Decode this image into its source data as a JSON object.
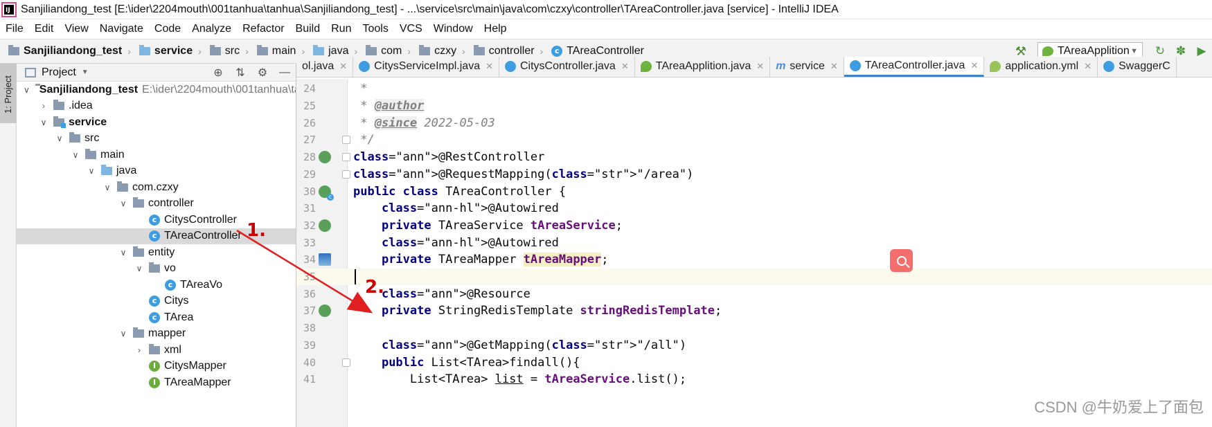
{
  "window": {
    "title": "Sanjiliandong_test [E:\\ider\\2204mouth\\001tanhua\\tanhua\\Sanjiliandong_test] - ...\\service\\src\\main\\java\\com\\czxy\\controller\\TAreaController.java [service] - IntelliJ IDEA"
  },
  "menu": [
    "File",
    "Edit",
    "View",
    "Navigate",
    "Code",
    "Analyze",
    "Refactor",
    "Build",
    "Run",
    "Tools",
    "VCS",
    "Window",
    "Help"
  ],
  "breadcrumb": [
    {
      "label": "Sanjiliandong_test",
      "icon": "folder",
      "bold": true
    },
    {
      "label": "service",
      "icon": "module-folder",
      "bold": true
    },
    {
      "label": "src",
      "icon": "folder"
    },
    {
      "label": "main",
      "icon": "folder"
    },
    {
      "label": "java",
      "icon": "source-folder"
    },
    {
      "label": "com",
      "icon": "folder"
    },
    {
      "label": "czxy",
      "icon": "folder"
    },
    {
      "label": "controller",
      "icon": "folder"
    },
    {
      "label": "TAreaController",
      "icon": "class-icon"
    }
  ],
  "toolbar": {
    "run_config": "TAreaApplition"
  },
  "left_stripe": {
    "label": "1: Project"
  },
  "project_panel": {
    "title": "Project",
    "tree": [
      {
        "label": "Sanjiliandong_test",
        "path": "E:\\ider\\2204mouth\\001tanhua\\tanh",
        "depth": 0,
        "expanded": true,
        "icon": "folder",
        "bold": true
      },
      {
        "label": ".idea",
        "depth": 1,
        "expanded": false,
        "icon": "folder"
      },
      {
        "label": "service",
        "depth": 1,
        "expanded": true,
        "icon": "module-folder",
        "bold": true
      },
      {
        "label": "src",
        "depth": 2,
        "expanded": true,
        "icon": "folder"
      },
      {
        "label": "main",
        "depth": 3,
        "expanded": true,
        "icon": "folder"
      },
      {
        "label": "java",
        "depth": 4,
        "expanded": true,
        "icon": "source-folder"
      },
      {
        "label": "com.czxy",
        "depth": 5,
        "expanded": true,
        "icon": "folder"
      },
      {
        "label": "controller",
        "depth": 6,
        "expanded": true,
        "icon": "folder"
      },
      {
        "label": "CitysController",
        "depth": 7,
        "icon": "class"
      },
      {
        "label": "TAreaController",
        "depth": 7,
        "icon": "class",
        "selected": true
      },
      {
        "label": "entity",
        "depth": 6,
        "expanded": true,
        "icon": "folder"
      },
      {
        "label": "vo",
        "depth": 7,
        "expanded": true,
        "icon": "folder"
      },
      {
        "label": "TAreaVo",
        "depth": 8,
        "icon": "class"
      },
      {
        "label": "Citys",
        "depth": 7,
        "icon": "class"
      },
      {
        "label": "TArea",
        "depth": 7,
        "icon": "class"
      },
      {
        "label": "mapper",
        "depth": 6,
        "expanded": true,
        "icon": "folder"
      },
      {
        "label": "xml",
        "depth": 7,
        "expanded": false,
        "icon": "folder"
      },
      {
        "label": "CitysMapper",
        "depth": 7,
        "icon": "interface"
      },
      {
        "label": "TAreaMapper",
        "depth": 7,
        "icon": "interface"
      }
    ]
  },
  "editor_tabs": [
    {
      "label": "ol.java",
      "icon": "none"
    },
    {
      "label": "CitysServiceImpl.java",
      "icon": "class"
    },
    {
      "label": "CitysController.java",
      "icon": "class"
    },
    {
      "label": "TAreaApplition.java",
      "icon": "spring"
    },
    {
      "label": "service",
      "icon": "m"
    },
    {
      "label": "TAreaController.java",
      "icon": "class",
      "active": true
    },
    {
      "label": "application.yml",
      "icon": "yml"
    },
    {
      "label": "SwaggerC",
      "icon": "class"
    }
  ],
  "code_lines": [
    {
      "n": "24",
      "text": " *"
    },
    {
      "n": "25",
      "text": " * @author"
    },
    {
      "n": "26",
      "text": " * @since 2022-05-03"
    },
    {
      "n": "27",
      "text": " */"
    },
    {
      "n": "28",
      "text": "@RestController"
    },
    {
      "n": "29",
      "text": "@RequestMapping(\"/area\")"
    },
    {
      "n": "30",
      "text": "public class TAreaController {"
    },
    {
      "n": "31",
      "text": "    @Autowired"
    },
    {
      "n": "32",
      "text": "    private TAreaService tAreaService;"
    },
    {
      "n": "33",
      "text": "    @Autowired"
    },
    {
      "n": "34",
      "text": "    private TAreaMapper tAreaMapper;"
    },
    {
      "n": "35",
      "text": ""
    },
    {
      "n": "36",
      "text": "    @Resource"
    },
    {
      "n": "37",
      "text": "    private StringRedisTemplate stringRedisTemplate;"
    },
    {
      "n": "38",
      "text": ""
    },
    {
      "n": "39",
      "text": "    @GetMapping(\"/all\")"
    },
    {
      "n": "40",
      "text": "    public List<TArea>findall(){"
    },
    {
      "n": "41",
      "text": "        List<TArea> list = tAreaService.list();"
    }
  ],
  "annotations": {
    "step1": "1.",
    "step2": "2."
  },
  "watermark": "CSDN @牛奶爱上了面包",
  "colors": {
    "keyword": "#000080",
    "annotation": "#808000",
    "string": "#067d17",
    "field": "#660e7a",
    "comment": "#808080",
    "arrow": "#e02020",
    "active_tab_underline": "#4083c9"
  }
}
